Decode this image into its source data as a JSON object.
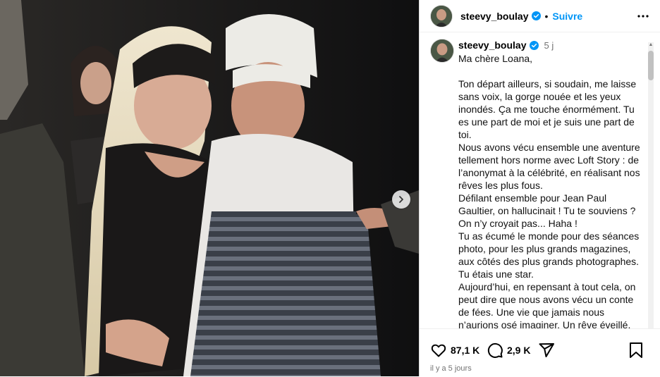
{
  "post": {
    "username": "steevy_boulay",
    "follow_label": "Suivre",
    "dot": "•",
    "caption_time": "5 j",
    "caption_text": "Ma chère Loana,\n\nTon départ ailleurs, si soudain, me laisse sans voix, la gorge nouée et les yeux inondés. Ça me touche énormément. Tu es une part de moi et je suis une part de toi.\nNous avons vécu ensemble une aventure tellement hors norme avec Loft Story : de l’anonymat à la célébrité, en réalisant nos rêves les plus fous.\nDéfilant ensemble pour Jean Paul Gaultier, on hallucinait ! Tu te souviens ? On n’y croyait pas... Haha !\nTu as écumé le monde pour des séances photo, pour les plus grands magazines, aux côtés des plus grands photographes. Tu étais une star.\nAujourd’hui, en repensant à tout cela, on peut dire que nous avons vécu un conte de fées. Une vie que jamais nous n’aurions osé imaginer. Un rêve éveillé,",
    "likes": "87,1 K",
    "comments": "2,9 K",
    "posted_ago": "il y a 5 jours"
  },
  "colors": {
    "follow": "#0095f6",
    "verified": "#0095f6",
    "muted": "#737373"
  },
  "icons": [
    "verified-badge-icon",
    "more-options-icon",
    "chevron-right-icon",
    "heart-icon",
    "comment-icon",
    "share-icon",
    "bookmark-icon"
  ]
}
